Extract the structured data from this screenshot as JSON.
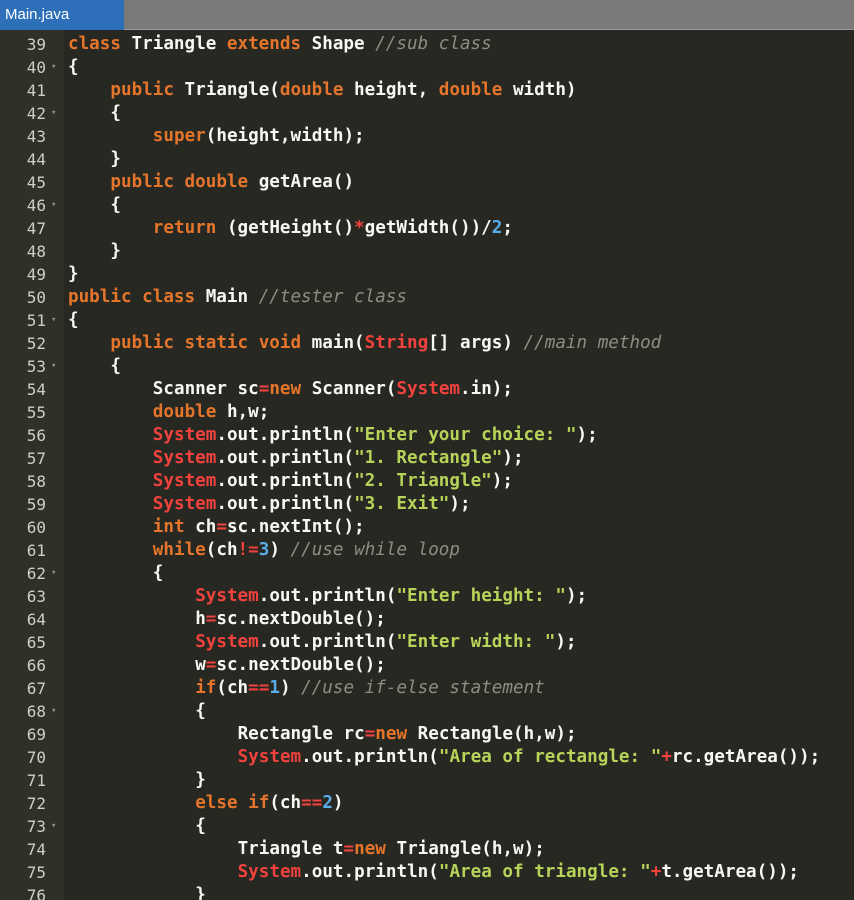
{
  "tab": {
    "filename": "Main.java"
  },
  "colors": {
    "keyword": "#e6752c",
    "comment": "#8d8d84",
    "string": "#b7d35a",
    "number": "#58aeea",
    "type": "#f2423e",
    "background": "#272822",
    "tab_active": "#2d6fb8"
  },
  "editor": {
    "lines": [
      {
        "n": "39",
        "fold": "",
        "indent": 0,
        "tokens": [
          [
            "k",
            "class"
          ],
          [
            "p",
            " Triangle "
          ],
          [
            "k",
            "extends"
          ],
          [
            "p",
            " Shape "
          ],
          [
            "c",
            "//sub class"
          ]
        ]
      },
      {
        "n": "40",
        "fold": "▾",
        "indent": 0,
        "tokens": [
          [
            "p",
            "{"
          ]
        ]
      },
      {
        "n": "41",
        "fold": "",
        "indent": 4,
        "tokens": [
          [
            "k",
            "public"
          ],
          [
            "p",
            " Triangle("
          ],
          [
            "k",
            "double"
          ],
          [
            "p",
            " height, "
          ],
          [
            "k",
            "double"
          ],
          [
            "p",
            " width)"
          ]
        ]
      },
      {
        "n": "42",
        "fold": "▾",
        "indent": 4,
        "tokens": [
          [
            "p",
            "{"
          ]
        ]
      },
      {
        "n": "43",
        "fold": "",
        "indent": 8,
        "tokens": [
          [
            "k",
            "super"
          ],
          [
            "p",
            "(height,width);"
          ]
        ]
      },
      {
        "n": "44",
        "fold": "",
        "indent": 4,
        "tokens": [
          [
            "p",
            "}"
          ]
        ]
      },
      {
        "n": "45",
        "fold": "",
        "indent": 4,
        "tokens": [
          [
            "k",
            "public"
          ],
          [
            "p",
            " "
          ],
          [
            "k",
            "double"
          ],
          [
            "p",
            " getArea()"
          ]
        ]
      },
      {
        "n": "46",
        "fold": "▾",
        "indent": 4,
        "tokens": [
          [
            "p",
            "{"
          ]
        ]
      },
      {
        "n": "47",
        "fold": "",
        "indent": 8,
        "tokens": [
          [
            "k",
            "return"
          ],
          [
            "p",
            " (getHeight()"
          ],
          [
            "o",
            "*"
          ],
          [
            "p",
            "getWidth())/"
          ],
          [
            "n",
            "2"
          ],
          [
            "p",
            ";"
          ]
        ]
      },
      {
        "n": "48",
        "fold": "",
        "indent": 4,
        "tokens": [
          [
            "p",
            "}"
          ]
        ]
      },
      {
        "n": "49",
        "fold": "",
        "indent": 0,
        "tokens": [
          [
            "p",
            "}"
          ]
        ]
      },
      {
        "n": "50",
        "fold": "",
        "indent": 0,
        "tokens": [
          [
            "k",
            "public"
          ],
          [
            "p",
            " "
          ],
          [
            "k",
            "class"
          ],
          [
            "p",
            " Main "
          ],
          [
            "c",
            "//tester class"
          ]
        ]
      },
      {
        "n": "51",
        "fold": "▾",
        "indent": 0,
        "tokens": [
          [
            "p",
            "{"
          ]
        ]
      },
      {
        "n": "52",
        "fold": "",
        "indent": 4,
        "tokens": [
          [
            "k",
            "public"
          ],
          [
            "p",
            " "
          ],
          [
            "k",
            "static"
          ],
          [
            "p",
            " "
          ],
          [
            "k",
            "void"
          ],
          [
            "p",
            " main("
          ],
          [
            "t",
            "String"
          ],
          [
            "p",
            "[] args) "
          ],
          [
            "c",
            "//main method"
          ]
        ]
      },
      {
        "n": "53",
        "fold": "▾",
        "indent": 4,
        "tokens": [
          [
            "p",
            "{"
          ]
        ]
      },
      {
        "n": "54",
        "fold": "",
        "indent": 8,
        "tokens": [
          [
            "p",
            "Scanner sc"
          ],
          [
            "o",
            "="
          ],
          [
            "k",
            "new"
          ],
          [
            "p",
            " Scanner("
          ],
          [
            "t",
            "System"
          ],
          [
            "p",
            ".in);"
          ]
        ]
      },
      {
        "n": "55",
        "fold": "",
        "indent": 8,
        "tokens": [
          [
            "k",
            "double"
          ],
          [
            "p",
            " h,w;"
          ]
        ]
      },
      {
        "n": "56",
        "fold": "",
        "indent": 8,
        "tokens": [
          [
            "t",
            "System"
          ],
          [
            "p",
            ".out.println("
          ],
          [
            "s",
            "\"Enter your choice: \""
          ],
          [
            "p",
            ");"
          ]
        ]
      },
      {
        "n": "57",
        "fold": "",
        "indent": 8,
        "tokens": [
          [
            "t",
            "System"
          ],
          [
            "p",
            ".out.println("
          ],
          [
            "s",
            "\"1. Rectangle\""
          ],
          [
            "p",
            ");"
          ]
        ]
      },
      {
        "n": "58",
        "fold": "",
        "indent": 8,
        "tokens": [
          [
            "t",
            "System"
          ],
          [
            "p",
            ".out.println("
          ],
          [
            "s",
            "\"2. Triangle\""
          ],
          [
            "p",
            ");"
          ]
        ]
      },
      {
        "n": "59",
        "fold": "",
        "indent": 8,
        "tokens": [
          [
            "t",
            "System"
          ],
          [
            "p",
            ".out.println("
          ],
          [
            "s",
            "\"3. Exit\""
          ],
          [
            "p",
            ");"
          ]
        ]
      },
      {
        "n": "60",
        "fold": "",
        "indent": 8,
        "tokens": [
          [
            "k",
            "int"
          ],
          [
            "p",
            " ch"
          ],
          [
            "o",
            "="
          ],
          [
            "p",
            "sc.nextInt();"
          ]
        ]
      },
      {
        "n": "61",
        "fold": "",
        "indent": 8,
        "tokens": [
          [
            "k",
            "while"
          ],
          [
            "p",
            "(ch"
          ],
          [
            "o",
            "!="
          ],
          [
            "n",
            "3"
          ],
          [
            "p",
            ") "
          ],
          [
            "c",
            "//use while loop"
          ]
        ]
      },
      {
        "n": "62",
        "fold": "▾",
        "indent": 8,
        "tokens": [
          [
            "p",
            "{"
          ]
        ]
      },
      {
        "n": "63",
        "fold": "",
        "indent": 12,
        "tokens": [
          [
            "t",
            "System"
          ],
          [
            "p",
            ".out.println("
          ],
          [
            "s",
            "\"Enter height: \""
          ],
          [
            "p",
            ");"
          ]
        ]
      },
      {
        "n": "64",
        "fold": "",
        "indent": 12,
        "tokens": [
          [
            "p",
            "h"
          ],
          [
            "o",
            "="
          ],
          [
            "p",
            "sc.nextDouble();"
          ]
        ]
      },
      {
        "n": "65",
        "fold": "",
        "indent": 12,
        "tokens": [
          [
            "t",
            "System"
          ],
          [
            "p",
            ".out.println("
          ],
          [
            "s",
            "\"Enter width: \""
          ],
          [
            "p",
            ");"
          ]
        ]
      },
      {
        "n": "66",
        "fold": "",
        "indent": 12,
        "tokens": [
          [
            "p",
            "w"
          ],
          [
            "o",
            "="
          ],
          [
            "p",
            "sc.nextDouble();"
          ]
        ]
      },
      {
        "n": "67",
        "fold": "",
        "indent": 12,
        "tokens": [
          [
            "k",
            "if"
          ],
          [
            "p",
            "(ch"
          ],
          [
            "o",
            "=="
          ],
          [
            "n",
            "1"
          ],
          [
            "p",
            ") "
          ],
          [
            "c",
            "//use if-else statement"
          ]
        ]
      },
      {
        "n": "68",
        "fold": "▾",
        "indent": 12,
        "tokens": [
          [
            "p",
            "{"
          ]
        ]
      },
      {
        "n": "69",
        "fold": "",
        "indent": 16,
        "tokens": [
          [
            "p",
            "Rectangle rc"
          ],
          [
            "o",
            "="
          ],
          [
            "k",
            "new"
          ],
          [
            "p",
            " Rectangle(h,w);"
          ]
        ]
      },
      {
        "n": "70",
        "fold": "",
        "indent": 16,
        "tokens": [
          [
            "t",
            "System"
          ],
          [
            "p",
            ".out.println("
          ],
          [
            "s",
            "\"Area of rectangle: \""
          ],
          [
            "o",
            "+"
          ],
          [
            "p",
            "rc.getArea());"
          ]
        ]
      },
      {
        "n": "71",
        "fold": "",
        "indent": 12,
        "tokens": [
          [
            "p",
            "}"
          ]
        ]
      },
      {
        "n": "72",
        "fold": "",
        "indent": 12,
        "tokens": [
          [
            "k",
            "else"
          ],
          [
            "p",
            " "
          ],
          [
            "k",
            "if"
          ],
          [
            "p",
            "(ch"
          ],
          [
            "o",
            "=="
          ],
          [
            "n",
            "2"
          ],
          [
            "p",
            ")"
          ]
        ]
      },
      {
        "n": "73",
        "fold": "▾",
        "indent": 12,
        "tokens": [
          [
            "p",
            "{"
          ]
        ]
      },
      {
        "n": "74",
        "fold": "",
        "indent": 16,
        "tokens": [
          [
            "p",
            "Triangle t"
          ],
          [
            "o",
            "="
          ],
          [
            "k",
            "new"
          ],
          [
            "p",
            " Triangle(h,w);"
          ]
        ]
      },
      {
        "n": "75",
        "fold": "",
        "indent": 16,
        "tokens": [
          [
            "t",
            "System"
          ],
          [
            "p",
            ".out.println("
          ],
          [
            "s",
            "\"Area of triangle: \""
          ],
          [
            "o",
            "+"
          ],
          [
            "p",
            "t.getArea());"
          ]
        ]
      },
      {
        "n": "76",
        "fold": "",
        "indent": 12,
        "tokens": [
          [
            "p",
            "}"
          ]
        ]
      }
    ]
  }
}
